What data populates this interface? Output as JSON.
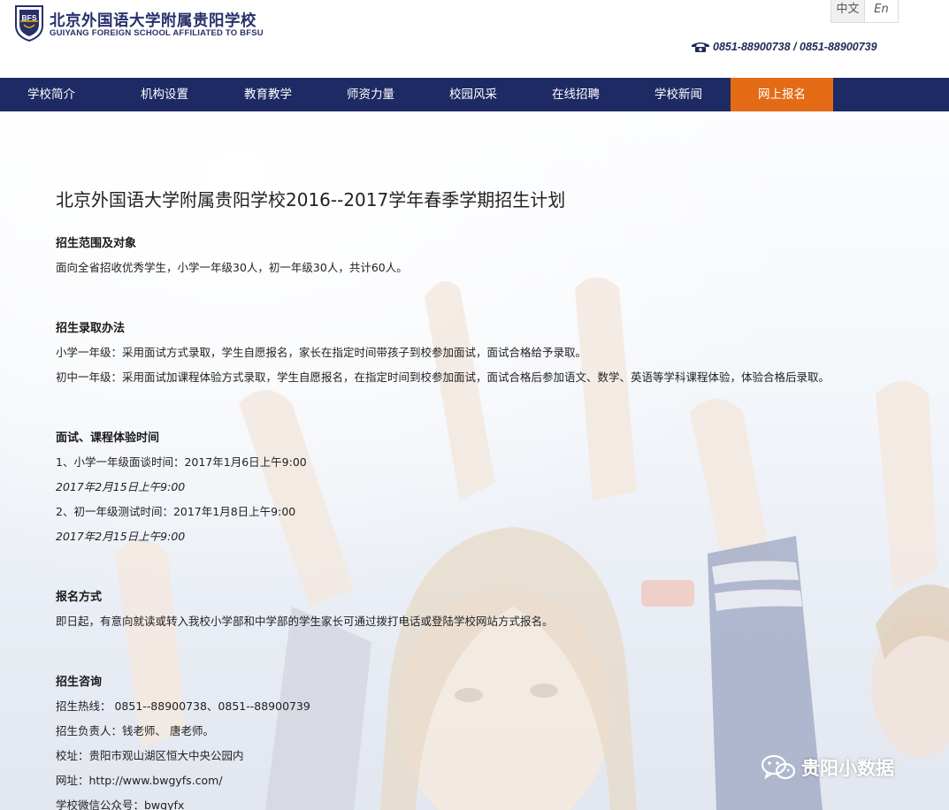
{
  "header": {
    "logo_text": "BFS",
    "school_name_cn": "北京外国语大学附属贵阳学校",
    "school_name_en": "GUIYANG FOREIGN SCHOOL AFFILIATED TO BFSU",
    "lang": [
      {
        "label": "中文",
        "active": true
      },
      {
        "label": "En",
        "active": false
      }
    ],
    "phone": "0851-88900738 / 0851-88900739",
    "colors": {
      "brand": "#27306b",
      "nav": "#1e2a63",
      "active": "#e46b16"
    }
  },
  "nav": {
    "items": [
      {
        "label": "学校简介"
      },
      {
        "label": "机构设置"
      },
      {
        "label": "教育教学"
      },
      {
        "label": "师资力量"
      },
      {
        "label": "校园风采"
      },
      {
        "label": "在线招聘"
      },
      {
        "label": "学校新闻"
      },
      {
        "label": "网上报名",
        "active": true
      }
    ]
  },
  "article": {
    "title": "北京外国语大学附属贵阳学校2016--2017学年春季学期招生计划",
    "sections": [
      {
        "heading": "招生范围及对象",
        "lines": [
          "面向全省招收优秀学生，小学一年级30人，初一年级30人，共计60人。"
        ]
      },
      {
        "heading": "招生录取办法",
        "lines": [
          "小学一年级：采用面试方式录取，学生自愿报名，家长在指定时间带孩子到校参加面试，面试合格给予录取。",
          "初中一年级：采用面试加课程体验方式录取，学生自愿报名，在指定时间到校参加面试，面试合格后参加语文、数学、英语等学科课程体验，体验合格后录取。"
        ]
      },
      {
        "heading": "面试、课程体验时间",
        "lines": [
          "1、小学一年级面谈时间：2017年1月6日上午9:00",
          "2017年2月15日上午9:00",
          "2、初一年级测试时间：2017年1月8日上午9:00",
          "2017年2月15日上午9:00"
        ]
      },
      {
        "heading": "报名方式",
        "lines": [
          "即日起，有意向就读或转入我校小学部和中学部的学生家长可通过拨打电话或登陆学校网站方式报名。"
        ]
      },
      {
        "heading": "招生咨询",
        "lines": [
          "招生热线： 0851--88900738、0851--88900739",
          "招生负责人：钱老师、 唐老师。",
          "校址：贵阳市观山湖区恒大中央公园内",
          "网址：http://www.bwgyfs.com/",
          "学校微信公众号：bwgyfx"
        ]
      }
    ]
  },
  "watermark": {
    "text": "贵阳小数据",
    "icon": "wechat-icon"
  }
}
